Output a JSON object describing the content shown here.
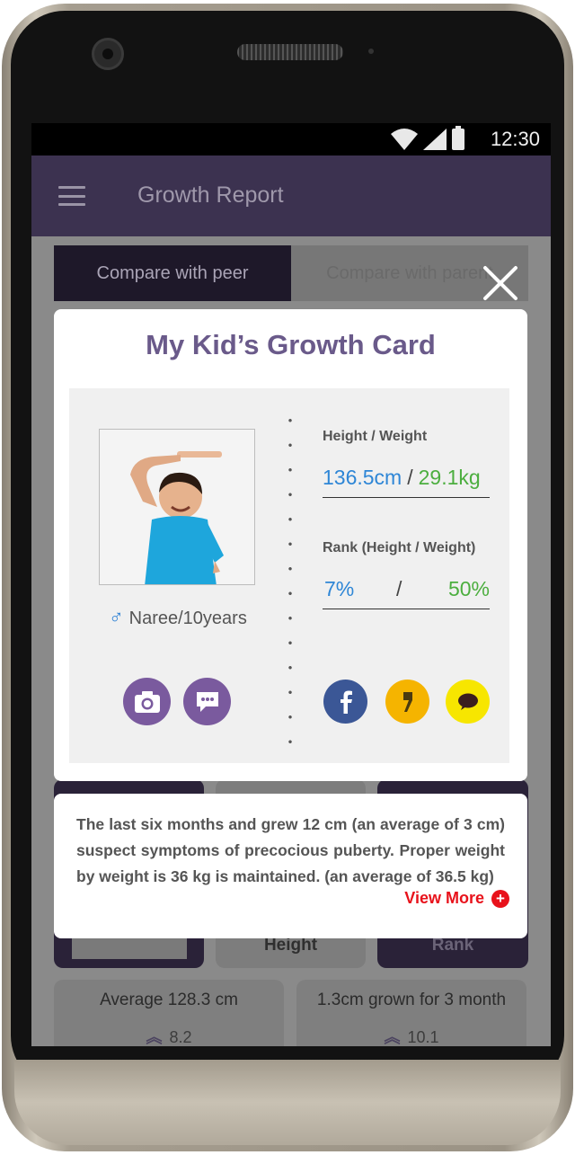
{
  "status_bar": {
    "time": "12:30"
  },
  "app_bar": {
    "title": "Growth Report",
    "menu_icon": "hamburger-icon"
  },
  "tabs": [
    {
      "label": "Compare with peer",
      "active": true
    },
    {
      "label": "Compare with parent",
      "active": false
    }
  ],
  "modal": {
    "title": "My Kid’s Growth Card",
    "kid": {
      "name": "Naree/10years",
      "gender_icon": "male-icon"
    },
    "height_weight": {
      "label": "Height / Weight",
      "height": "136.5cm",
      "separator": "/",
      "weight": "29.1kg"
    },
    "rank": {
      "label": "Rank (Height / Weight)",
      "height_rank": "7%",
      "separator": "/",
      "weight_rank": "50%"
    },
    "action_icons": [
      "camera-icon",
      "chat-icon"
    ],
    "share_icons": [
      "facebook-icon",
      "kakaostory-icon",
      "kakaotalk-icon"
    ]
  },
  "info": {
    "text": "The last six months and grew 12 cm (an average of 3 cm) suspect symptoms of precocious puberty. Proper weight by weight is 36 kg is maintained. (an average of 36.5 kg)",
    "view_more": "View More"
  },
  "background": {
    "cards": [
      {
        "label": ""
      },
      {
        "label": "Height"
      },
      {
        "label": "Rank"
      }
    ],
    "stats": [
      {
        "title": "Average 128.3 cm",
        "value": "8.2"
      },
      {
        "title": "1.3cm grown for 3 month",
        "value": "10.1"
      }
    ]
  },
  "colors": {
    "accent": "#6a5a8a",
    "height": "#2e86d6",
    "weight": "#4cae3f",
    "view_more": "#e8121b",
    "appbar": "#3c3250"
  }
}
